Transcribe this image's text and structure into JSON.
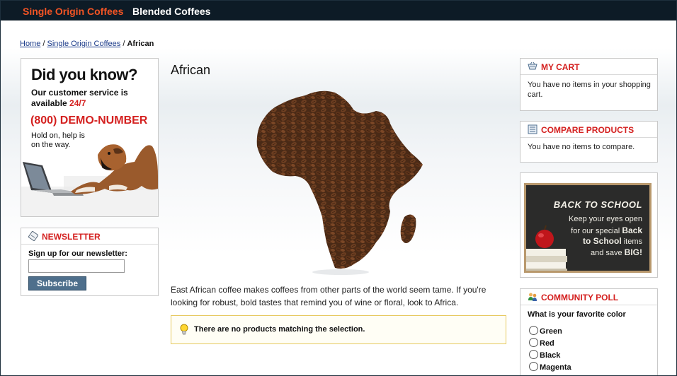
{
  "nav": {
    "items": [
      {
        "label": "Single Origin Coffees"
      },
      {
        "label": "Blended Coffees"
      }
    ]
  },
  "breadcrumb": {
    "home": "Home",
    "separator": " / ",
    "category": "Single Origin Coffees",
    "current": "African"
  },
  "left": {
    "ad": {
      "title": "Did you know?",
      "line1": "Our customer service is",
      "line2_prefix": "available ",
      "line2_highlight": "24/7",
      "phone": "(800) DEMO-NUMBER",
      "hold1": "Hold on, help is",
      "hold2": "on the way."
    },
    "newsletter": {
      "title": "NEWSLETTER",
      "icon": "newsletter-icon",
      "label": "Sign up for our newsletter:",
      "input_value": "",
      "button_label": "Subscribe"
    }
  },
  "main": {
    "title": "African",
    "description": "East African coffee makes coffees from other parts of the world seem tame. If you're looking for robust, bold tastes that remind you of wine or floral, look to Africa.",
    "notice": "There are no products matching the selection.",
    "notice_icon": "lightbulb-icon"
  },
  "right": {
    "cart": {
      "title": "MY CART",
      "icon": "cart-icon",
      "body": "You have no items in your shopping cart."
    },
    "compare": {
      "title": "COMPARE PRODUCTS",
      "icon": "list-icon",
      "body": "You have no items to compare."
    },
    "promo": {
      "heading": "BACK TO SCHOOL",
      "line1": "Keep your eyes open",
      "line2_prefix": "for our special ",
      "line2_bold": "Back",
      "line3_bold": "to School",
      "line3_suffix": " items",
      "line4_prefix": "and save ",
      "line4_bold": "BIG!"
    },
    "poll": {
      "title": "COMMUNITY POLL",
      "icon": "people-icon",
      "question": "What is your favorite color",
      "options": [
        {
          "label": "Green"
        },
        {
          "label": "Red"
        },
        {
          "label": "Black"
        },
        {
          "label": "Magenta"
        }
      ]
    }
  },
  "colors": {
    "accent_red": "#d4201f",
    "nav_active": "#f35424",
    "nav_bg": "#0d1b26",
    "button_blue": "#4e6f8c"
  }
}
